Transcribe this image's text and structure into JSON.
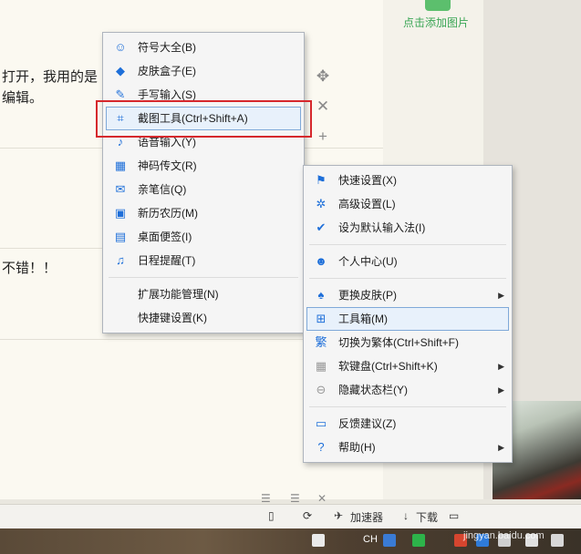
{
  "editor": {
    "line1": "打开，我用的是",
    "line2": "编辑。",
    "line3": "不错！！",
    "add_image": "点击添加图片"
  },
  "side_tools": [
    "move-icon",
    "close-icon",
    "plus-icon"
  ],
  "menu_left": {
    "items": [
      {
        "label": "符号大全(B)",
        "icon": "smiley-icon"
      },
      {
        "label": "皮肤盒子(E)",
        "icon": "cube-icon"
      },
      {
        "label": "手写输入(S)",
        "icon": "pen-icon"
      },
      {
        "label": "截图工具(Ctrl+Shift+A)",
        "icon": "crop-icon"
      },
      {
        "label": "语音输入(Y)",
        "icon": "mic-icon"
      },
      {
        "label": "神码传文(R)",
        "icon": "qrcode-icon"
      },
      {
        "label": "亲笔信(Q)",
        "icon": "envelope-icon"
      },
      {
        "label": "新历农历(M)",
        "icon": "calendar-icon"
      },
      {
        "label": "桌面便签(I)",
        "icon": "note-icon"
      },
      {
        "label": "日程提醒(T)",
        "icon": "bell-icon"
      }
    ],
    "extra": [
      "扩展功能管理(N)",
      "快捷键设置(K)"
    ]
  },
  "menu_right": {
    "group1": [
      {
        "label": "快速设置(X)",
        "icon": "flag-icon"
      },
      {
        "label": "高级设置(L)",
        "icon": "gear-icon"
      },
      {
        "label": "设为默认输入法(I)",
        "icon": "check-circle-icon"
      }
    ],
    "group2": [
      {
        "label": "个人中心(U)",
        "icon": "user-icon"
      }
    ],
    "group3": [
      {
        "label": "更换皮肤(P)",
        "icon": "shirt-icon"
      },
      {
        "label": "工具箱(M)",
        "icon": "grid-icon"
      },
      {
        "label": "切换为繁体(Ctrl+Shift+F)",
        "icon": "fan-icon"
      },
      {
        "label": "软键盘(Ctrl+Shift+K)",
        "icon": "keyboard-icon"
      },
      {
        "label": "隐藏状态栏(Y)",
        "icon": "minus-circle-icon"
      }
    ],
    "group4": [
      {
        "label": "反馈建议(Z)",
        "icon": "chat-icon"
      },
      {
        "label": "帮助(H)",
        "icon": "help-icon"
      }
    ]
  },
  "toolbar": {
    "accelerator": "加速器",
    "download": "下载"
  },
  "taskbar": {
    "lang": "CH"
  },
  "watermark": "jingyan.baidu.com"
}
